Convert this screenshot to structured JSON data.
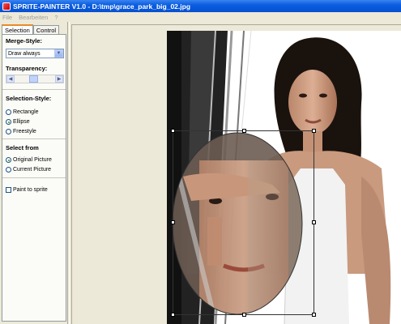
{
  "window": {
    "title": "SPRITE-PAINTER V1.0 - D:\\tmp\\grace_park_big_02.jpg"
  },
  "menu": {
    "items": [
      "File",
      "Bearbeiten",
      "?"
    ]
  },
  "tabs": [
    "Selection",
    "Control"
  ],
  "merge_style": {
    "label": "Merge-Style:",
    "value": "Draw always"
  },
  "transparency": {
    "label": "Transparency:",
    "value_fraction": 0.45
  },
  "selection_style": {
    "label": "Selection-Style:",
    "options": [
      "Rectangle",
      "Ellipse",
      "Freestyle"
    ],
    "selected": "Ellipse"
  },
  "select_from": {
    "label": "Select from",
    "options": [
      "Original Picture",
      "Current Picture"
    ],
    "selected": "Original Picture"
  },
  "paint_to_sprite": {
    "label": "Paint to sprite",
    "checked": false
  },
  "icons": {
    "dropdown": "chevron-down-icon",
    "left": "arrow-left-icon",
    "right": "arrow-right-icon"
  }
}
